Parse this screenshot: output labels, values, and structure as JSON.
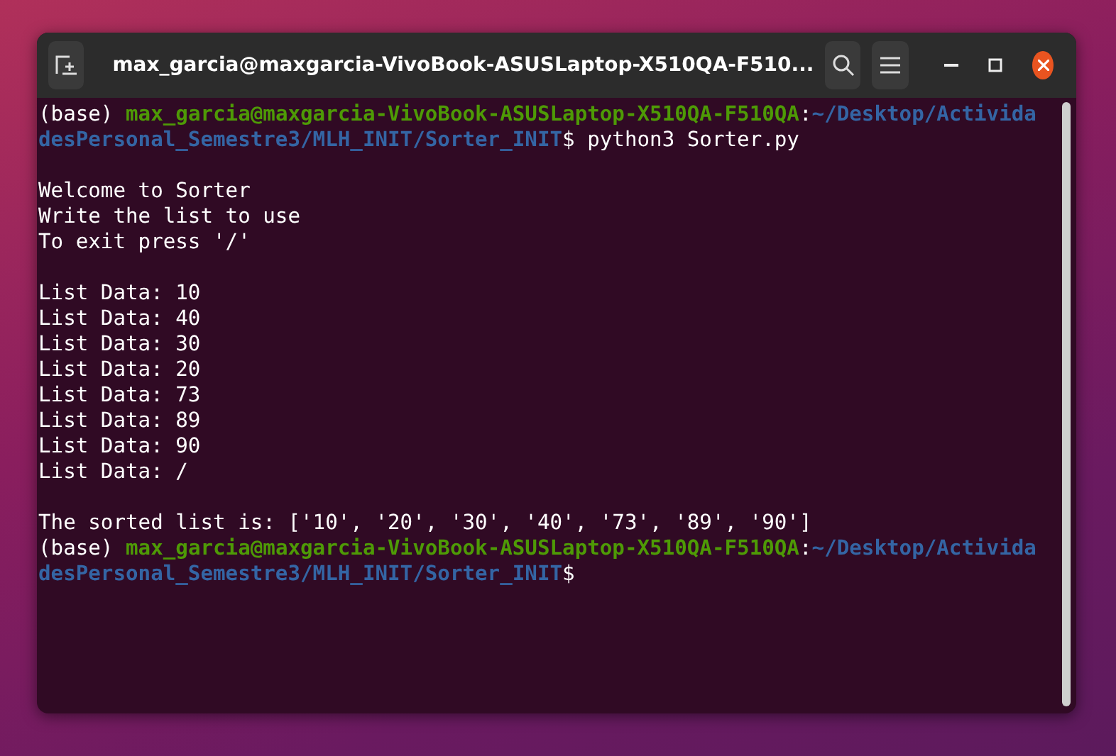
{
  "window": {
    "title": "max_garcia@maxgarcia-VivoBook-ASUSLaptop-X510QA-F510..."
  },
  "terminal": {
    "lines": [
      {
        "kind": "text",
        "segments": [
          {
            "kind": "plain",
            "text": "(base) "
          },
          {
            "kind": "user",
            "text": "max_garcia@maxgarcia-VivoBook-ASUSLaptop-X510QA-F510QA"
          },
          {
            "kind": "plain",
            "text": ":"
          },
          {
            "kind": "path",
            "text": "~/Desktop/Activida"
          }
        ]
      },
      {
        "kind": "text",
        "segments": [
          {
            "kind": "path",
            "text": "desPersonal_Semestre3/MLH_INIT/Sorter_INIT"
          },
          {
            "kind": "plain",
            "text": "$ python3 Sorter.py"
          }
        ]
      },
      {
        "kind": "blank"
      },
      {
        "kind": "text",
        "segments": [
          {
            "kind": "plain",
            "text": "Welcome to Sorter"
          }
        ]
      },
      {
        "kind": "text",
        "segments": [
          {
            "kind": "plain",
            "text": "Write the list to use"
          }
        ]
      },
      {
        "kind": "text",
        "segments": [
          {
            "kind": "plain",
            "text": "To exit press '/'"
          }
        ]
      },
      {
        "kind": "blank"
      },
      {
        "kind": "text",
        "segments": [
          {
            "kind": "plain",
            "text": "List Data: 10"
          }
        ]
      },
      {
        "kind": "text",
        "segments": [
          {
            "kind": "plain",
            "text": "List Data: 40"
          }
        ]
      },
      {
        "kind": "text",
        "segments": [
          {
            "kind": "plain",
            "text": "List Data: 30"
          }
        ]
      },
      {
        "kind": "text",
        "segments": [
          {
            "kind": "plain",
            "text": "List Data: 20"
          }
        ]
      },
      {
        "kind": "text",
        "segments": [
          {
            "kind": "plain",
            "text": "List Data: 73"
          }
        ]
      },
      {
        "kind": "text",
        "segments": [
          {
            "kind": "plain",
            "text": "List Data: 89"
          }
        ]
      },
      {
        "kind": "text",
        "segments": [
          {
            "kind": "plain",
            "text": "List Data: 90"
          }
        ]
      },
      {
        "kind": "text",
        "segments": [
          {
            "kind": "plain",
            "text": "List Data: /"
          }
        ]
      },
      {
        "kind": "blank"
      },
      {
        "kind": "text",
        "segments": [
          {
            "kind": "plain",
            "text": "The sorted list is: ['10', '20', '30', '40', '73', '89', '90']"
          }
        ]
      },
      {
        "kind": "text",
        "segments": [
          {
            "kind": "plain",
            "text": "(base) "
          },
          {
            "kind": "user",
            "text": "max_garcia@maxgarcia-VivoBook-ASUSLaptop-X510QA-F510QA"
          },
          {
            "kind": "plain",
            "text": ":"
          },
          {
            "kind": "path",
            "text": "~/Desktop/Activida"
          }
        ]
      },
      {
        "kind": "text",
        "segments": [
          {
            "kind": "path",
            "text": "desPersonal_Semestre3/MLH_INIT/Sorter_INIT"
          },
          {
            "kind": "plain",
            "text": "$"
          }
        ]
      }
    ]
  }
}
